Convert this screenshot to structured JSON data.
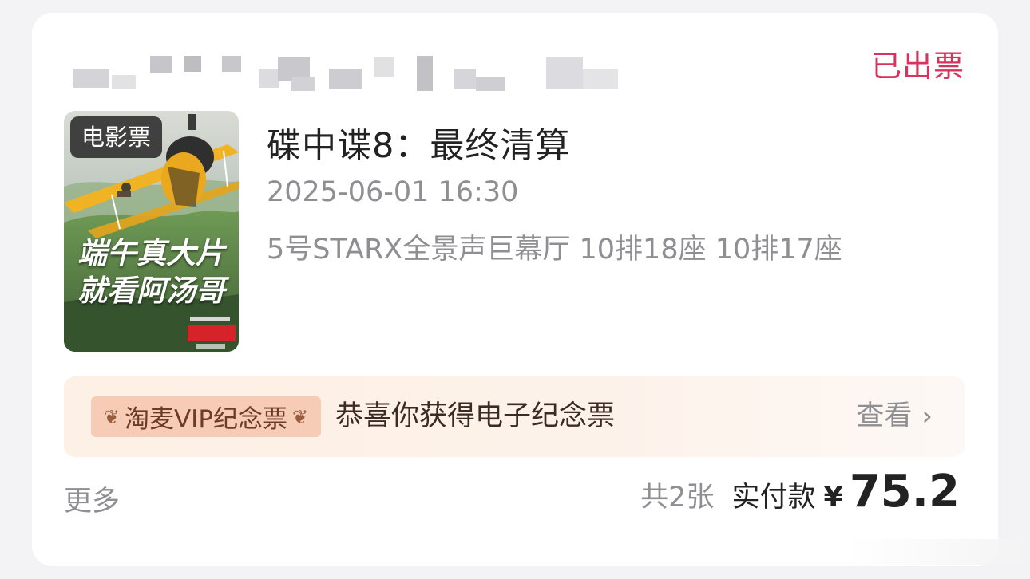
{
  "order": {
    "status": "已出票",
    "poster": {
      "badge": "电影票",
      "slogan_line1": "端午真大片",
      "slogan_line2": "就看阿汤哥"
    },
    "movie_title": "碟中谍8：最终清算",
    "show_time": "2025-06-01 16:30",
    "hall_seats": "5号STARX全景声巨幕厅 10排18座 10排17座",
    "vip": {
      "tag": "淘麦VIP纪念票",
      "message": "恭喜你获得电子纪念票",
      "view_label": "查看",
      "chevron": "›"
    },
    "more_label": "更多",
    "ticket_count": "共2张",
    "paid_label": "实付款",
    "currency": "¥",
    "amount": "75.2"
  },
  "colors": {
    "status": "#d6345c",
    "banner_bg": "#fdf0e4",
    "tag_bg": "#f6ccb6"
  },
  "icons": [
    "wheat-laurel-icon",
    "chevron-right-icon"
  ]
}
